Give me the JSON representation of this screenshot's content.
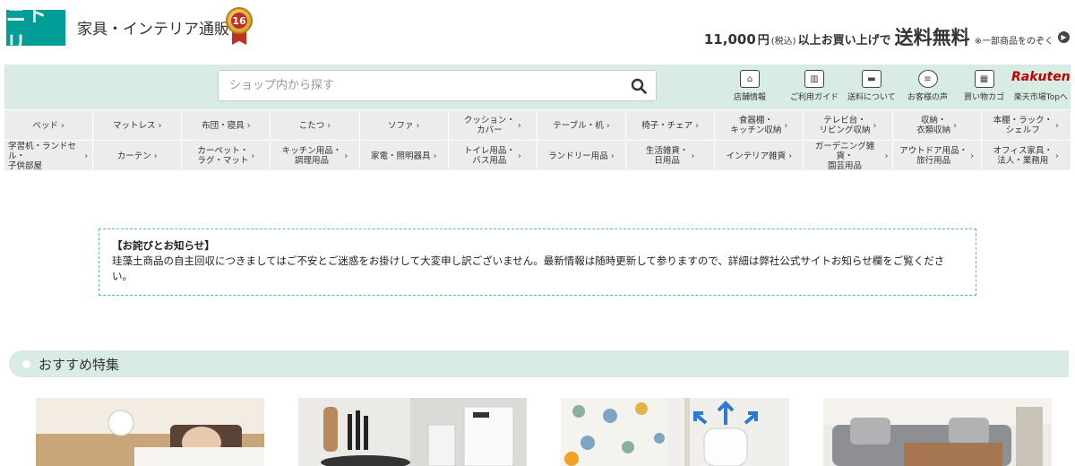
{
  "header": {
    "logo_text": "ニトリ",
    "shop_name": "家具・インテリア通販",
    "badge_number": "16",
    "promo": {
      "amount": "11,000",
      "yen": "円",
      "tax": "(税込)",
      "condition": "以上お買い上げで",
      "free_shipping": "送料無料",
      "note": "※一部商品をのぞく"
    }
  },
  "search": {
    "placeholder": "ショップ内から探す"
  },
  "utility_links": [
    {
      "label": "店舗情報",
      "icon": "store-icon"
    },
    {
      "label": "ご利用ガイド",
      "icon": "guide-book-icon"
    },
    {
      "label": "送料について",
      "icon": "truck-icon"
    },
    {
      "label": "お客様の声",
      "icon": "chat-bubble-icon"
    },
    {
      "label": "買い物カゴ",
      "icon": "cart-icon"
    },
    {
      "label": "楽天市場Topへ",
      "logo": "Rakuten"
    }
  ],
  "categories_row1": [
    "ベッド",
    "マットレス",
    "布団・寝具",
    "こたつ",
    "ソファ",
    "クッション・\nカバー",
    "テーブル・机",
    "椅子・チェア",
    "食器棚・\nキッチン収納",
    "テレビ台・\nリビング収納",
    "収納・\n衣類収納",
    "本棚・ラック・\nシェルフ"
  ],
  "categories_row2": [
    "学習机・ランドセ\nル・\n子供部屋",
    "カーテン",
    "カーペット・\nラグ・マット",
    "キッチン用品・\n調理用品",
    "家電・照明器具",
    "トイレ用品・\nバス用品",
    "ランドリー用品",
    "生活雑貨・\n日用品",
    "インテリア雑貨",
    "ガーデニング雑貨・\n園芸用品",
    "アウトドア用品・\n旅行用品",
    "オフィス家具・\n法人・業務用"
  ],
  "notice": {
    "title": "【お詫びとお知らせ】",
    "body": "珪藻土商品の自主回収につきましてはご不安とご迷惑をお掛けして大変申し訳ございません。最新情報は随時更新して参りますので、詳細は弊社公式サイトお知らせ欄をご覧ください。"
  },
  "section": {
    "title": "おすすめ特集"
  },
  "colors": {
    "brand": "#009e96",
    "mint": "#d8ece4",
    "nav_bg": "#ececec",
    "rakuten": "#bf0000"
  }
}
